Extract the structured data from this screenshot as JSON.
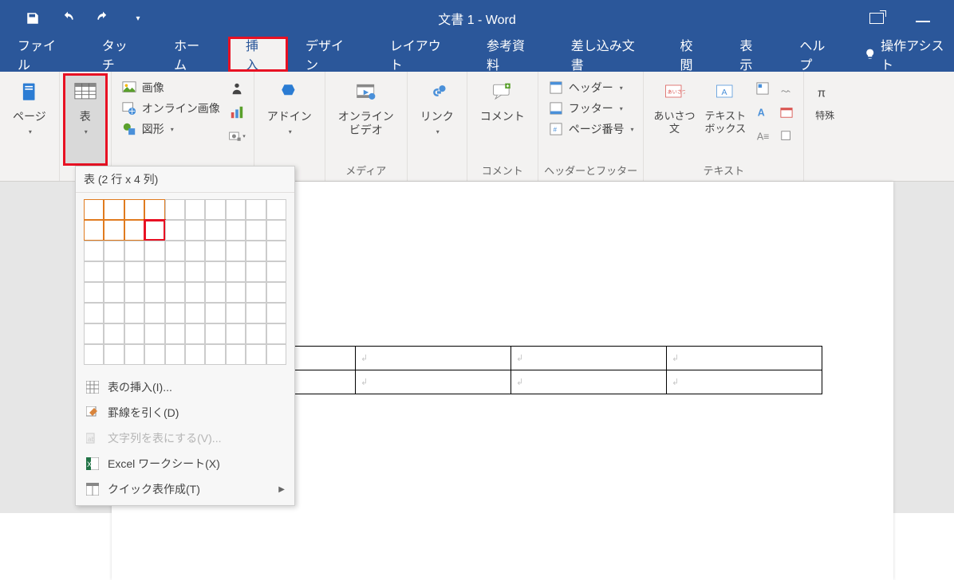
{
  "title": "文書 1  -  Word",
  "tabs": [
    "ファイル",
    "タッチ",
    "ホーム",
    "挿入",
    "デザイン",
    "レイアウト",
    "参考資料",
    "差し込み文書",
    "校閲",
    "表示",
    "ヘルプ"
  ],
  "active_tab_index": 3,
  "tell_me": "操作アシスト",
  "ribbon": {
    "page": {
      "label": "ページ"
    },
    "table": {
      "label": "表"
    },
    "illustrations": {
      "image": "画像",
      "online_image": "オンライン画像",
      "shapes": "図形"
    },
    "addins": {
      "label": "アドイン"
    },
    "media": {
      "label": "オンライン\nビデオ",
      "group": "メディア"
    },
    "links": {
      "label": "リンク"
    },
    "comments": {
      "label": "コメント",
      "group": "コメント"
    },
    "headerfooter": {
      "header": "ヘッダー",
      "footer": "フッター",
      "pagenum": "ページ番号",
      "group": "ヘッダーとフッター"
    },
    "text": {
      "greeting": "あいさつ\n文",
      "textbox": "テキスト\nボックス",
      "group": "テキスト"
    },
    "symbols": {
      "label": "特殊"
    }
  },
  "table_dropdown": {
    "title": "表 (2 行 x 4 列)",
    "rows": 8,
    "cols": 10,
    "sel_rows": 2,
    "sel_cols": 4,
    "menu": {
      "insert": "表の挿入(I)...",
      "draw": "罫線を引く(D)",
      "convert": "文字列を表にする(V)...",
      "excel": "Excel ワークシート(X)",
      "quick": "クイック表作成(T)"
    }
  },
  "doc": {
    "table_rows": 2,
    "table_cols": 4
  }
}
